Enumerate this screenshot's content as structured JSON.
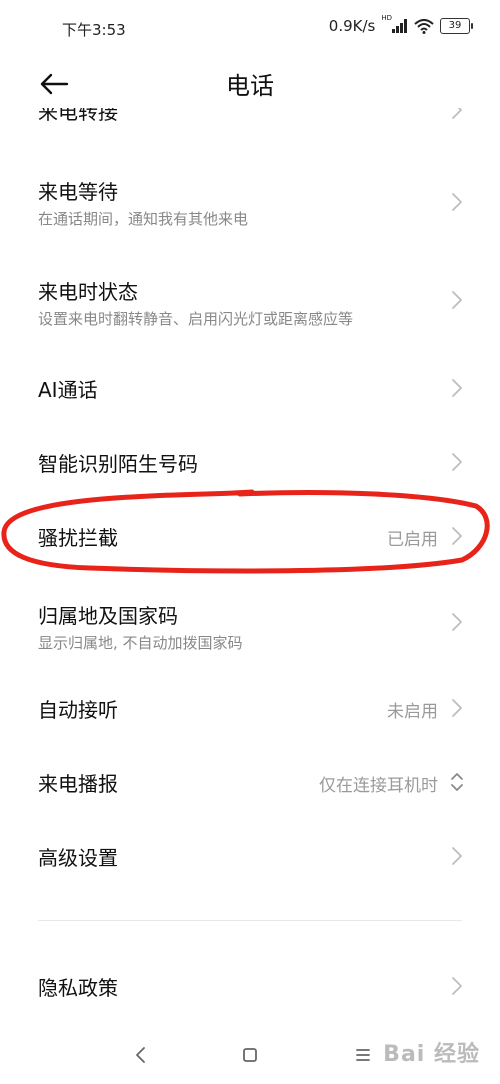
{
  "status_bar": {
    "time": "下午3:53",
    "net_speed": "0.9K/s",
    "hd": "HD",
    "battery": "39"
  },
  "header": {
    "title": "电话"
  },
  "settings": {
    "items": [
      {
        "title": "来电转接",
        "subtitle": "",
        "value": ""
      },
      {
        "title": "来电等待",
        "subtitle": "在通话期间，通知我有其他来电",
        "value": ""
      },
      {
        "title": "来电时状态",
        "subtitle": "设置来电时翻转静音、启用闪光灯或距离感应等",
        "value": ""
      },
      {
        "title": "AI通话",
        "subtitle": "",
        "value": ""
      },
      {
        "title": "智能识别陌生号码",
        "subtitle": "",
        "value": ""
      },
      {
        "title": "骚扰拦截",
        "subtitle": "",
        "value": "已启用"
      },
      {
        "title": "归属地及国家码",
        "subtitle": "显示归属地, 不自动加拨国家码",
        "value": ""
      },
      {
        "title": "自动接听",
        "subtitle": "",
        "value": "未启用"
      },
      {
        "title": "来电播报",
        "subtitle": "",
        "value": "仅在连接耳机时"
      },
      {
        "title": "高级设置",
        "subtitle": "",
        "value": ""
      }
    ],
    "privacy": {
      "title": "隐私政策"
    }
  },
  "annotation": {
    "color": "#e8231a"
  },
  "watermark": {
    "text": "Bai 经验"
  },
  "icons": {
    "back": "arrow-left-icon",
    "chevron": "chevron-right-icon",
    "stepper": "chevron-up-down-icon",
    "nav_back": "nav-back-icon",
    "nav_home": "nav-home-icon",
    "nav_menu": "nav-menu-icon"
  }
}
